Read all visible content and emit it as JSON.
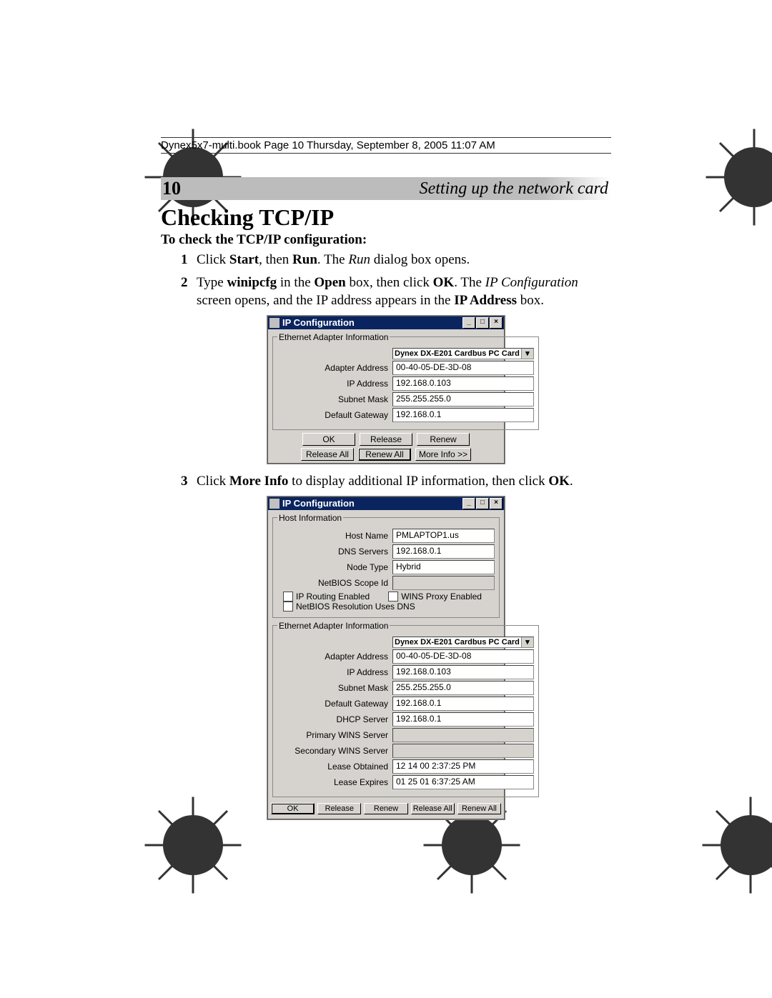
{
  "header_line": "Dynex5x7-multi.book  Page 10  Thursday, September 8, 2005  11:07 AM",
  "page_number": "10",
  "section_title": "Setting up the network card",
  "heading": "Checking TCP/IP",
  "subheading": "To check the TCP/IP configuration:",
  "steps": {
    "s1": {
      "num": "1",
      "pre": "Click ",
      "b1": "Start",
      "mid1": ", then ",
      "b2": "Run",
      "mid2": ". The ",
      "i1": "Run",
      "post": " dialog box opens."
    },
    "s2": {
      "num": "2",
      "pre": "Type ",
      "b1": "winipcfg",
      "mid1": " in the ",
      "b2": "Open",
      "mid2": " box, then click ",
      "b3": "OK",
      "mid3": ". The ",
      "i1": "IP Configuration",
      "mid4": " screen opens, and the IP address appears in the ",
      "b4": "IP Address",
      "post": " box."
    },
    "s3": {
      "num": "3",
      "pre": "Click ",
      "b1": "More Info",
      "mid1": " to display additional IP information, then click ",
      "b2": "OK",
      "post": "."
    }
  },
  "dlg1": {
    "title": "IP Configuration",
    "group": "Ethernet Adapter Information",
    "adapter": "Dynex DX-E201 Cardbus PC Card",
    "rows": {
      "adapter_address": {
        "label": "Adapter Address",
        "value": "00-40-05-DE-3D-08"
      },
      "ip_address": {
        "label": "IP Address",
        "value": "192.168.0.103"
      },
      "subnet_mask": {
        "label": "Subnet Mask",
        "value": "255.255.255.0"
      },
      "default_gateway": {
        "label": "Default Gateway",
        "value": "192.168.0.1"
      }
    },
    "btns1": {
      "ok": "OK",
      "release": "Release",
      "renew": "Renew"
    },
    "btns2": {
      "release_all": "Release All",
      "renew_all": "Renew All",
      "more_info": "More Info >>"
    }
  },
  "dlg2": {
    "title": "IP Configuration",
    "group1": "Host Information",
    "host": {
      "host_name": {
        "label": "Host Name",
        "value": "PMLAPTOP1.us"
      },
      "dns_servers": {
        "label": "DNS Servers",
        "value": "192.168.0.1"
      },
      "node_type": {
        "label": "Node Type",
        "value": "Hybrid"
      },
      "netbios_scope": {
        "label": "NetBIOS Scope Id",
        "value": ""
      },
      "ip_routing": {
        "label": "IP Routing Enabled",
        "value": ""
      },
      "wins_proxy": {
        "label": "WINS Proxy Enabled",
        "value": ""
      },
      "netbios_dns": {
        "label": "NetBIOS Resolution Uses DNS",
        "value": ""
      }
    },
    "group2": "Ethernet Adapter Information",
    "adapter": "Dynex DX-E201 Cardbus PC Card",
    "eth": {
      "adapter_address": {
        "label": "Adapter Address",
        "value": "00-40-05-DE-3D-08"
      },
      "ip_address": {
        "label": "IP Address",
        "value": "192.168.0.103"
      },
      "subnet_mask": {
        "label": "Subnet Mask",
        "value": "255.255.255.0"
      },
      "default_gateway": {
        "label": "Default Gateway",
        "value": "192.168.0.1"
      },
      "dhcp_server": {
        "label": "DHCP Server",
        "value": "192.168.0.1"
      },
      "primary_wins": {
        "label": "Primary WINS Server",
        "value": ""
      },
      "secondary_wins": {
        "label": "Secondary WINS Server",
        "value": ""
      },
      "lease_obtained": {
        "label": "Lease Obtained",
        "value": "12 14 00 2:37:25 PM"
      },
      "lease_expires": {
        "label": "Lease Expires",
        "value": "01 25 01 6:37:25 AM"
      }
    },
    "btns": {
      "ok": "OK",
      "release": "Release",
      "renew": "Renew",
      "release_all": "Release All",
      "renew_all": "Renew All"
    }
  }
}
